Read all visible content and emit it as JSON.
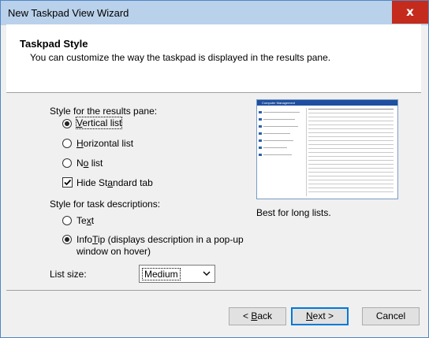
{
  "window": {
    "title": "New Taskpad View Wizard",
    "close_glyph": "x"
  },
  "header": {
    "title": "Taskpad Style",
    "subtitle": "You can customize the way the taskpad is displayed in the results pane."
  },
  "results_pane": {
    "label": "Style for the results pane:",
    "options": [
      {
        "pre": "",
        "ul": "V",
        "post": "ertical list",
        "selected": true
      },
      {
        "pre": "",
        "ul": "H",
        "post": "orizontal list",
        "selected": false
      },
      {
        "pre": "N",
        "ul": "o",
        "post": " list",
        "selected": false
      }
    ],
    "hide_tab": {
      "pre": "Hide St",
      "ul": "a",
      "post": "ndard tab",
      "checked": true
    }
  },
  "task_desc": {
    "label": "Style for task descriptions:",
    "options": [
      {
        "pre": "Te",
        "ul": "x",
        "post": "t",
        "selected": false
      },
      {
        "pre": "Info",
        "ul": "T",
        "post": "ip (displays description in a pop-up",
        "line2": "window on hover)",
        "selected": true
      }
    ]
  },
  "list_size": {
    "label": "List size:",
    "value": "Medium"
  },
  "preview": {
    "caption": "Best for long lists.",
    "mini_title": "Computer Management"
  },
  "buttons": {
    "back": {
      "pre": "< ",
      "ul": "B",
      "post": "ack"
    },
    "next": {
      "pre": "",
      "ul": "N",
      "post": "ext >"
    },
    "cancel": "Cancel"
  }
}
